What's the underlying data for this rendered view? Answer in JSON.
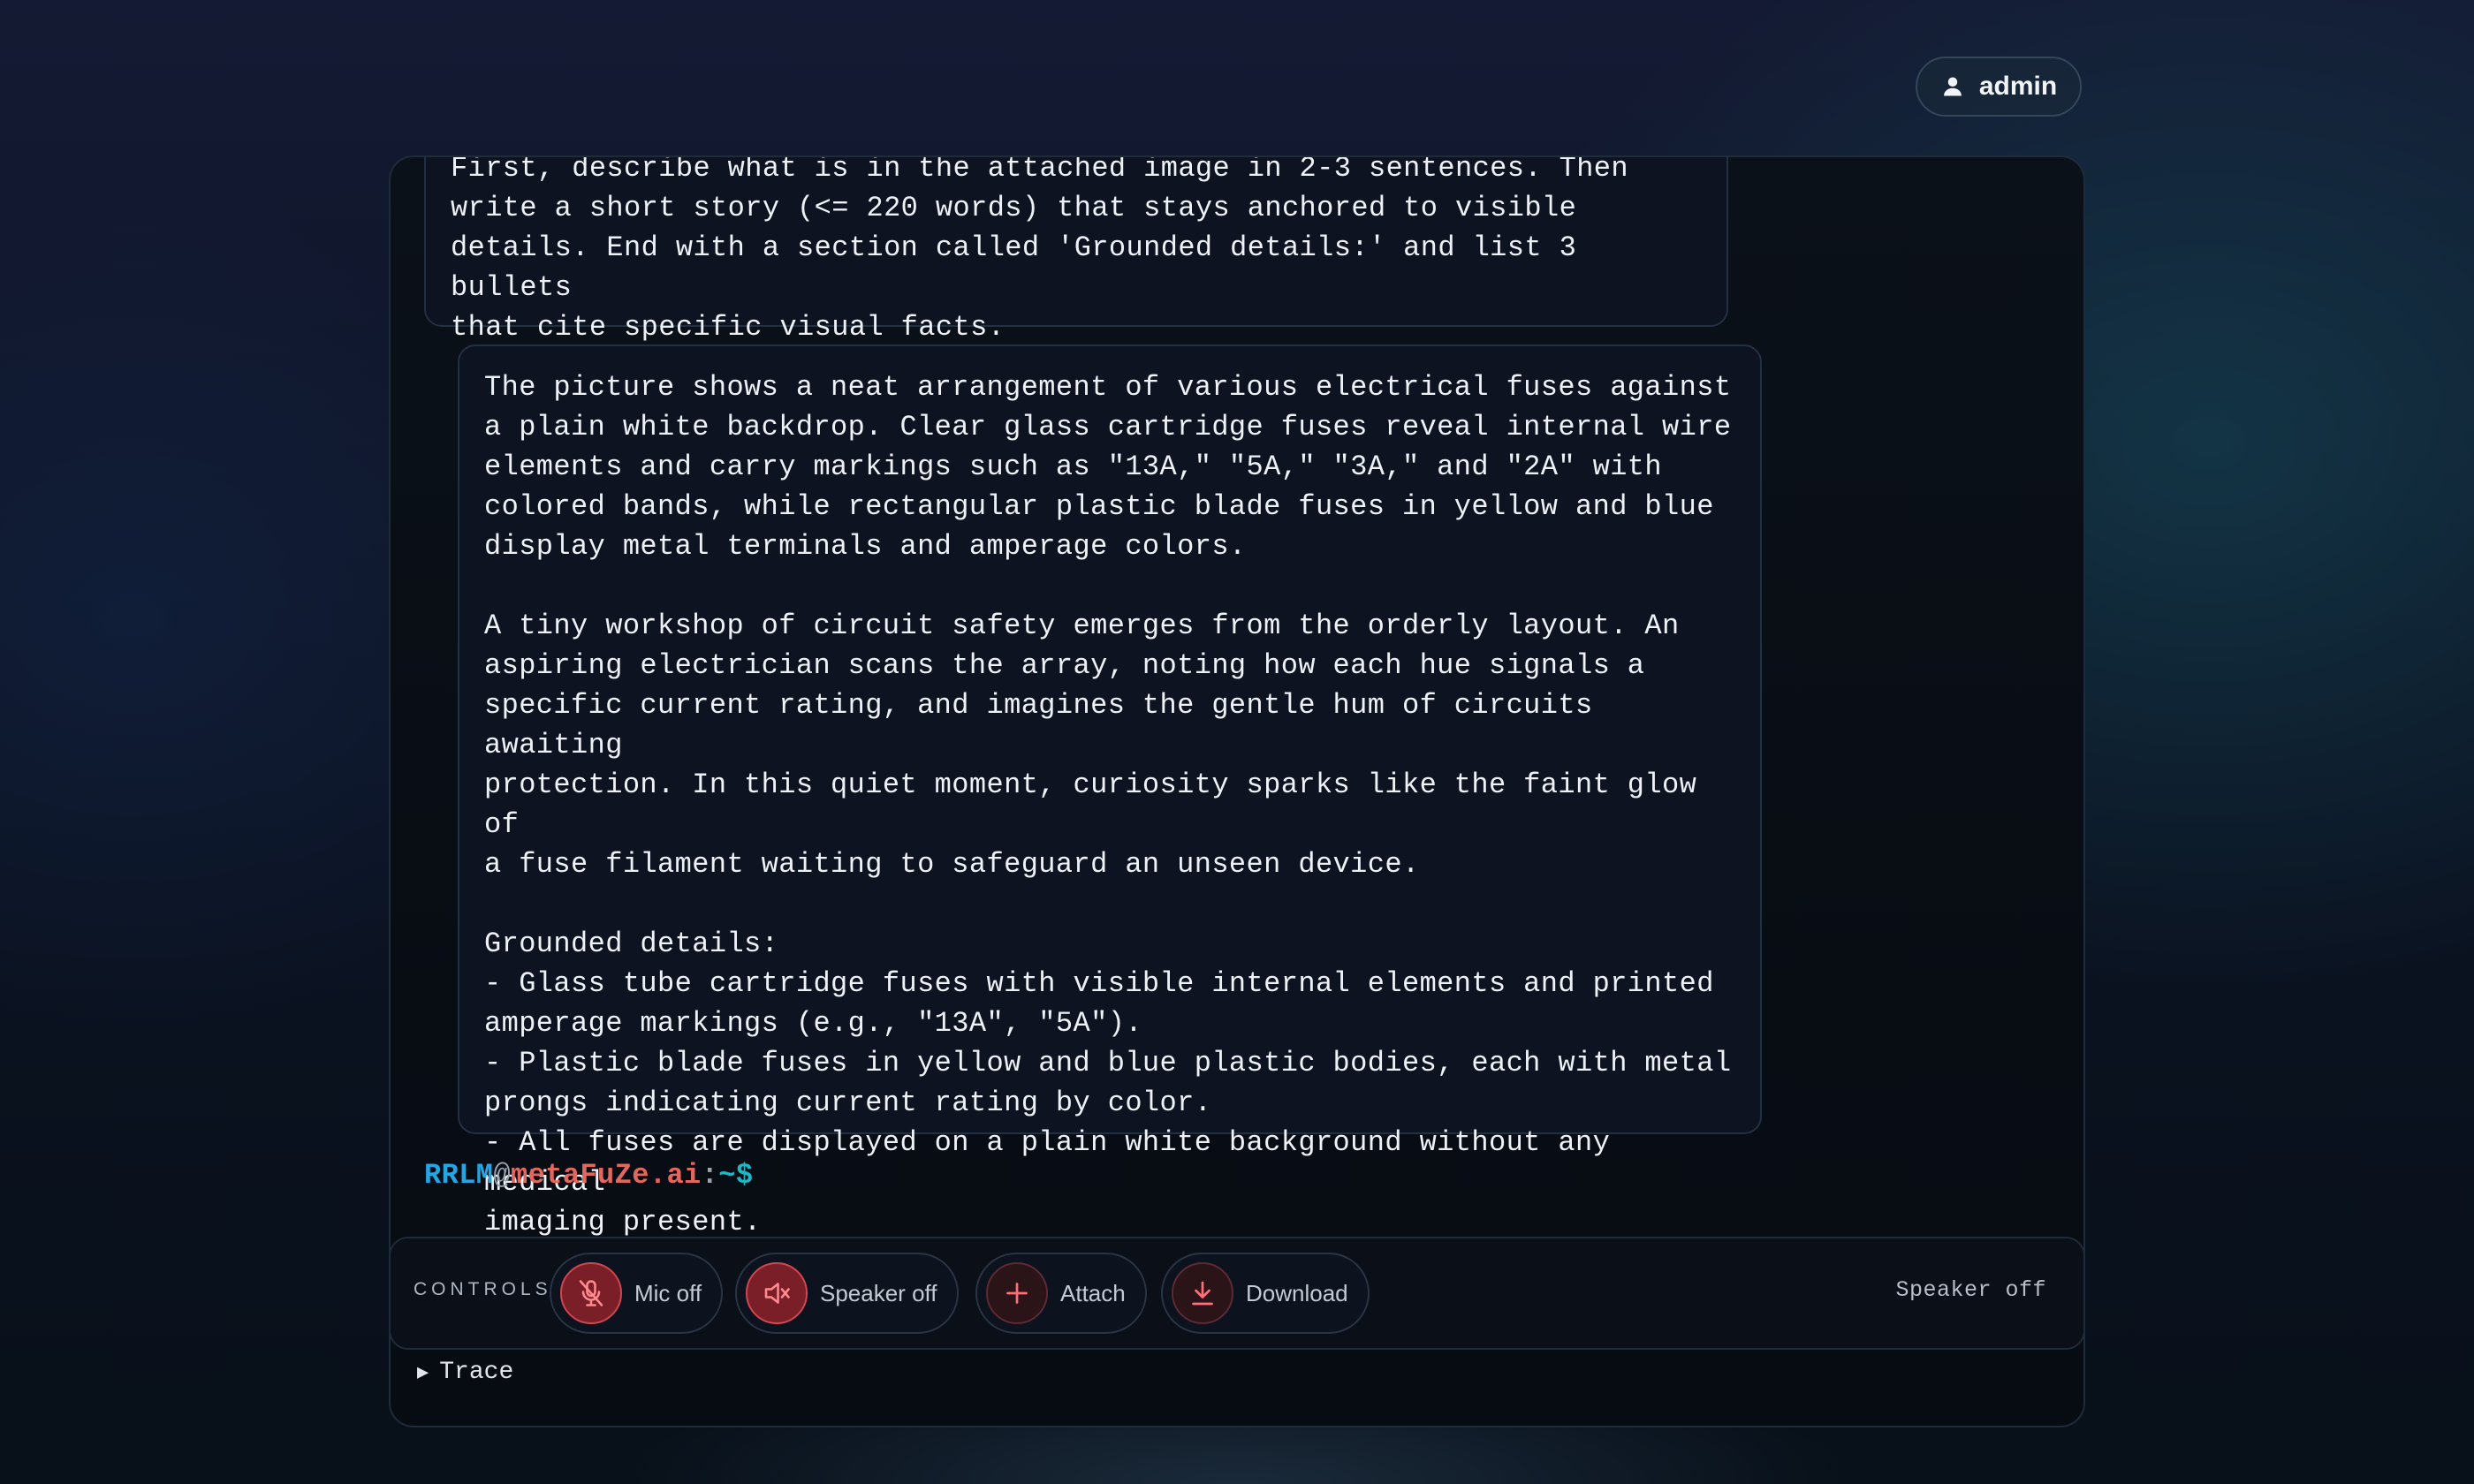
{
  "header": {
    "user_label": "admin",
    "user_icon": "user-icon"
  },
  "messages": {
    "user_prompt": "First, describe what is in the attached image in 2-3 sentences. Then\nwrite a short story (<= 220 words) that stays anchored to visible\ndetails. End with a section called 'Grounded details:' and list 3 bullets\nthat cite specific visual facts.",
    "assistant_reply": "The picture shows a neat arrangement of various electrical fuses against\na plain white backdrop. Clear glass cartridge fuses reveal internal wire\nelements and carry markings such as \"13A,\" \"5A,\" \"3A,\" and \"2A\" with\ncolored bands, while rectangular plastic blade fuses in yellow and blue\ndisplay metal terminals and amperage colors.\n\nA tiny workshop of circuit safety emerges from the orderly layout. An\naspiring electrician scans the array, noting how each hue signals a\nspecific current rating, and imagines the gentle hum of circuits awaiting\nprotection. In this quiet moment, curiosity sparks like the faint glow of\na fuse filament waiting to safeguard an unseen device.\n\nGrounded details:\n- Glass tube cartridge fuses with visible internal elements and printed\namperage markings (e.g., \"13A\", \"5A\").\n- Plastic blade fuses in yellow and blue plastic bodies, each with metal\nprongs indicating current rating by color.\n- All fuses are displayed on a plain white background without any medical\nimaging present."
  },
  "prompt": {
    "user": "RRLM",
    "at": "@",
    "host": "metaFuZe.ai",
    "colon": ":",
    "path": "~$"
  },
  "controls": {
    "label": "CONTROLS",
    "mic": {
      "label": "Mic off",
      "icon": "mic-off-icon"
    },
    "speaker": {
      "label": "Speaker off",
      "icon": "speaker-off-icon"
    },
    "attach": {
      "label": "Attach",
      "icon": "plus-icon"
    },
    "download": {
      "label": "Download",
      "icon": "download-icon"
    },
    "status": "Speaker off"
  },
  "trace": {
    "label": "Trace"
  },
  "colors": {
    "accent_red": "#d04650",
    "prompt_user": "#22a6e6",
    "prompt_host": "#e4675f",
    "prompt_path": "#1fb7c8"
  }
}
